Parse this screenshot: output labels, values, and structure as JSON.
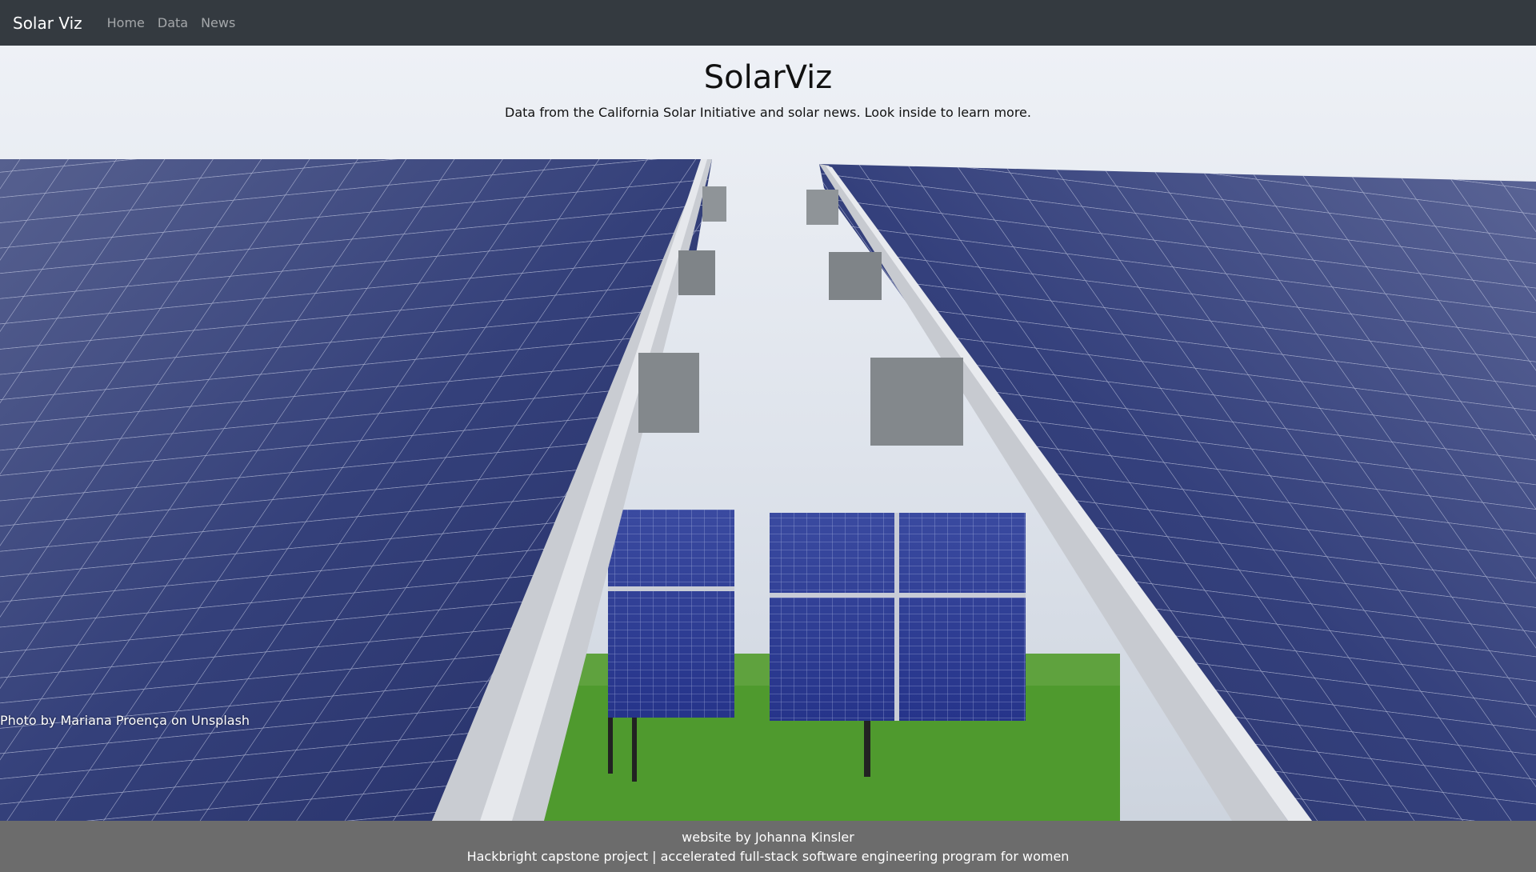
{
  "navbar": {
    "brand": "Solar Viz",
    "links": [
      "Home",
      "Data",
      "News"
    ]
  },
  "hero": {
    "title": "SolarViz",
    "subtitle": "Data from the California Solar Initiative and solar news. Look inside to learn more.",
    "photo_credit": "Photo by Mariana Proença on Unsplash"
  },
  "footer": {
    "line1": "website by Johanna Kinsler",
    "line2": "Hackbright capstone project | accelerated full-stack software engineering program for women"
  },
  "colors": {
    "navbar": "#343a40",
    "footer": "#6c6c6c",
    "panel": "#2c3a7a",
    "grass": "#4f9a2e"
  }
}
